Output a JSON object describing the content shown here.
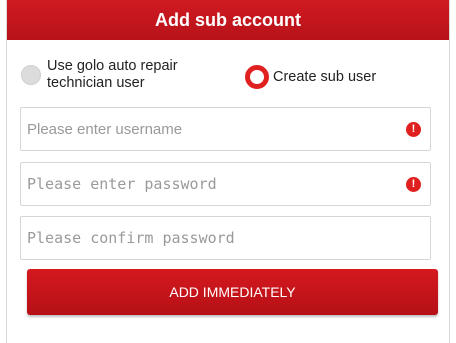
{
  "dialog": {
    "title": "Add sub account"
  },
  "account_type": {
    "options": [
      {
        "label": "Use golo auto repair technician user",
        "selected": false
      },
      {
        "label": "Create sub user",
        "selected": true
      }
    ]
  },
  "form": {
    "username_placeholder": "Please enter username",
    "password_placeholder": "Please enter password",
    "confirm_placeholder": "Please confirm password",
    "username_value": "",
    "password_value": "",
    "confirm_value": "",
    "warning_glyph": "!",
    "submit_label": "ADD IMMEDIATELY"
  },
  "colors": {
    "accent": "#c8161d",
    "selected_radio": "#e0211f",
    "unselected_radio": "#dcdcdc",
    "placeholder": "#9a9a9a"
  }
}
